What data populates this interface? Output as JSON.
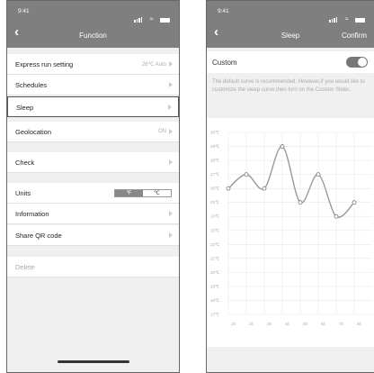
{
  "status": {
    "time": "9:41"
  },
  "left": {
    "header": {
      "title": "Function"
    },
    "rows": [
      {
        "label": "Express run setting",
        "value": "26℃ Auto"
      },
      {
        "label": "Schedules"
      },
      {
        "label": "Sleep"
      },
      {
        "label": "Geolocation",
        "value": "ON"
      },
      {
        "label": "Check"
      },
      {
        "label": "Units",
        "toggle": [
          "℉",
          "℃"
        ]
      },
      {
        "label": "Information"
      },
      {
        "label": "Share QR code"
      },
      {
        "label": "Delete"
      }
    ]
  },
  "right": {
    "header": {
      "title": "Sleep",
      "confirm": "Confirm"
    },
    "custom": {
      "label": "Custom",
      "enabled": true
    },
    "description": "The default curve is recommended. However,if you would like to customize the sleep curve,then turn on the Custom Slider.",
    "chart_data": {
      "type": "line",
      "y_ticks": [
        "30℃",
        "29℃",
        "28℃",
        "27℃",
        "26℃",
        "25℃",
        "24℃",
        "23℃",
        "22℃",
        "21℃",
        "20℃",
        "19℃",
        "18℃",
        "17℃"
      ],
      "x": [
        "1h",
        "2h",
        "3h",
        "4h",
        "5h",
        "6h",
        "7h",
        "8h"
      ],
      "x_points": [
        0,
        1,
        2,
        3,
        4,
        5,
        6,
        7
      ],
      "values": [
        26,
        27,
        26,
        29,
        25,
        27,
        24,
        25
      ],
      "ylim": [
        17,
        30
      ],
      "line_color": "#999999",
      "grid": true
    }
  }
}
